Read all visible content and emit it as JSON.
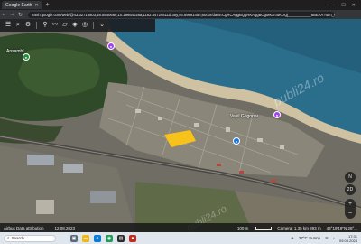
{
  "browser": {
    "tab_title": "Google Earth",
    "new_tab_symbol": "+",
    "url": "earth.google.com/web/@43.32713803,28.5840669,10.29664028a,1162.84729511d,35y,46.5989145h,60t,0r/data=CgRCAggBQgRKAggBOgMKATBKDQj___________8BEAA?utm_source=gmp.capabilit..."
  },
  "earth_toolbar": {
    "icons": [
      "menu-icon",
      "search-icon",
      "settings-icon",
      "projects-icon",
      "pin-icon",
      "path-icon",
      "ruler-icon",
      "layers-icon",
      "camera-icon",
      "collapse-icon"
    ]
  },
  "map": {
    "place_labels": [
      "Ansambl",
      "Vasil Grigorov"
    ],
    "watermark_text": "publi24.ro",
    "watermark_text_2": "publi24.ro"
  },
  "map_controls": {
    "compass_label": "N",
    "view_label": "2D",
    "zoom_in": "+",
    "zoom_out": "−"
  },
  "earth_status": {
    "attribution": "Airbus Data attribution",
    "date": "12.08.2023",
    "scale": "100 m",
    "camera": "Camera: 1.35 km   893 m",
    "coordinates": "43°19'19\"N 28°..."
  },
  "taskbar": {
    "search_placeholder": "Search",
    "weather": "27°C Sunny",
    "time": "17:31",
    "date": "09.08.2024"
  },
  "colors": {
    "sea": "#2b6e8c",
    "beach": "#cfc2a2",
    "forest": "#2f4a28",
    "highlight_plot": "#f7c21a",
    "pin_purple": "#a142f4",
    "pin_green": "#1e8e3e",
    "pin_blue": "#1a73e8"
  }
}
